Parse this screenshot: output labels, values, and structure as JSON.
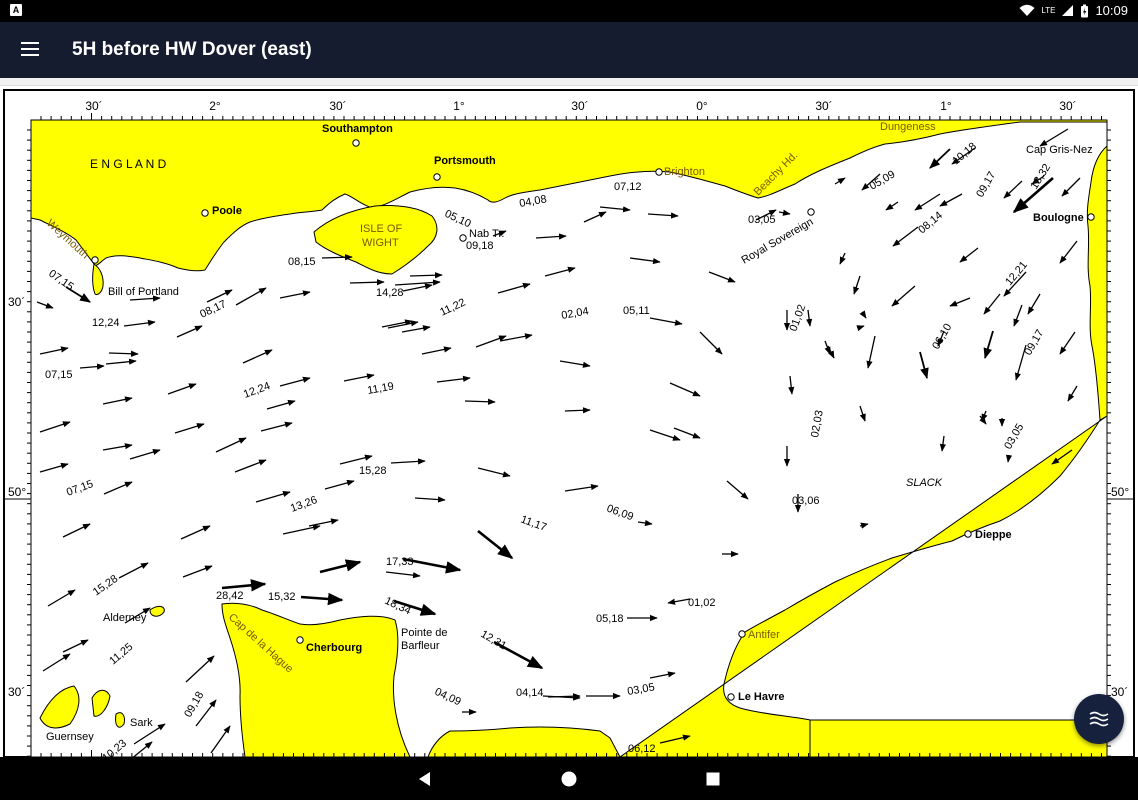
{
  "status": {
    "app_letter": "A",
    "network": "LTE",
    "time": "10:09"
  },
  "appbar": {
    "title": "5H before HW Dover (east)"
  },
  "map": {
    "top_ticks": [
      "30´",
      "2°",
      "30´",
      "1°",
      "30´",
      "0°",
      "30´",
      "1°",
      "30´"
    ],
    "lat_labels": [
      "30´",
      "50°",
      "50°",
      "30´",
      "30´"
    ],
    "places": {
      "england": "E N G L A N D",
      "southampton": "Southampton",
      "portsmouth": "Portsmouth",
      "brighton": "Brighton",
      "dungeness": "Dungeness",
      "cap_gris_nez": "Cap Gris-Nez",
      "boulogne": "Boulogne",
      "beachy_hd": "Beachy Hd.",
      "royal_sovereign": "Royal Sovereign",
      "poole": "Poole",
      "weymouth": "Weymouth",
      "isle_of_wight_1": "ISLE OF",
      "isle_of_wight_2": "WIGHT",
      "nab_tr": "Nab Tr.",
      "bill_of_portland": "Bill of Portland",
      "alderney": "Alderney",
      "cap_de_la_hague": "Cap de la Hague",
      "cherbourg": "Cherbourg",
      "pointe_de_barfleur_1": "Pointe de",
      "pointe_de_barfleur_2": "Barfleur",
      "antifer": "Antifer",
      "le_havre": "Le Havre",
      "dieppe": "Dieppe",
      "guernsey": "Guernsey",
      "sark": "Sark",
      "slack": "SLACK"
    },
    "rates": [
      "05,10",
      "09,18",
      "04,08",
      "07,12",
      "03,05",
      "10,18",
      "18,32",
      "05,09",
      "09,17",
      "08,14",
      "12,21",
      "07,15",
      "08,15",
      "08,17",
      "14,28",
      "12,24",
      "11,22",
      "02,04",
      "05,11",
      "01,02",
      "06,10",
      "09,17",
      "07,15",
      "12,24",
      "11,19",
      "02,03",
      "03,05",
      "07,15",
      "15,28",
      "13,26",
      "03,06",
      "06,09",
      "11,17",
      "15,28",
      "28,42",
      "15,32",
      "17,33",
      "18,34",
      "12,31",
      "01,02",
      "05,18",
      "11,25",
      "09,18",
      "04,09",
      "04,14",
      "03,05",
      "10,23",
      "06,12"
    ]
  },
  "colors": {
    "land": "#ffff00",
    "sea": "#ffffff",
    "appbar": "#161c30",
    "fab": "#16213e"
  },
  "fab": {
    "icon": "waves-icon"
  },
  "nav": {
    "back": "back-icon",
    "home": "home-icon",
    "recents": "recents-icon"
  }
}
